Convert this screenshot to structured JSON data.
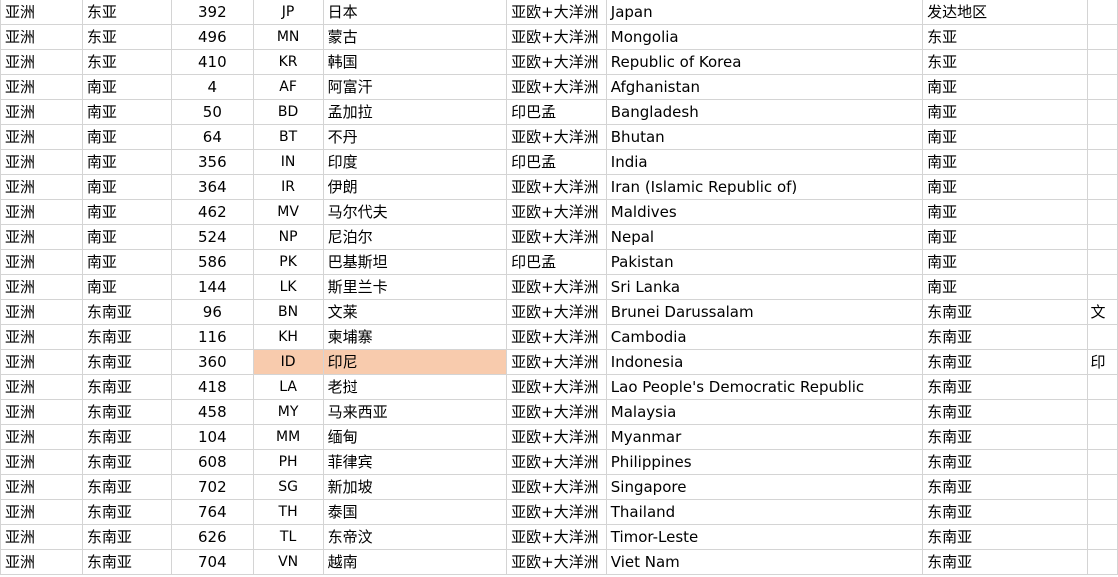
{
  "sheet": {
    "highlight_color": "#f8cbad",
    "rows": [
      {
        "continent": "亚洲",
        "region": "东亚",
        "number": "392",
        "code": "JP",
        "name_zh": "日本",
        "group": "亚欧+大洋洲",
        "name_en": "Japan",
        "category": "发达地区",
        "extra": ""
      },
      {
        "continent": "亚洲",
        "region": "东亚",
        "number": "496",
        "code": "MN",
        "name_zh": "蒙古",
        "group": "亚欧+大洋洲",
        "name_en": "Mongolia",
        "category": "东亚",
        "extra": ""
      },
      {
        "continent": "亚洲",
        "region": "东亚",
        "number": "410",
        "code": "KR",
        "name_zh": "韩国",
        "group": "亚欧+大洋洲",
        "name_en": "Republic of Korea",
        "category": "东亚",
        "extra": ""
      },
      {
        "continent": "亚洲",
        "region": "南亚",
        "number": "4",
        "code": "AF",
        "name_zh": "阿富汗",
        "group": "亚欧+大洋洲",
        "name_en": "Afghanistan",
        "category": "南亚",
        "extra": ""
      },
      {
        "continent": "亚洲",
        "region": "南亚",
        "number": "50",
        "code": "BD",
        "name_zh": "孟加拉",
        "group": "印巴孟",
        "name_en": "Bangladesh",
        "category": "南亚",
        "extra": ""
      },
      {
        "continent": "亚洲",
        "region": "南亚",
        "number": "64",
        "code": "BT",
        "name_zh": "不丹",
        "group": "亚欧+大洋洲",
        "name_en": "Bhutan",
        "category": "南亚",
        "extra": ""
      },
      {
        "continent": "亚洲",
        "region": "南亚",
        "number": "356",
        "code": "IN",
        "name_zh": "印度",
        "group": "印巴孟",
        "name_en": "India",
        "category": "南亚",
        "extra": ""
      },
      {
        "continent": "亚洲",
        "region": "南亚",
        "number": "364",
        "code": "IR",
        "name_zh": "伊朗",
        "group": "亚欧+大洋洲",
        "name_en": "Iran (Islamic Republic of)",
        "category": "南亚",
        "extra": ""
      },
      {
        "continent": "亚洲",
        "region": "南亚",
        "number": "462",
        "code": "MV",
        "name_zh": "马尔代夫",
        "group": "亚欧+大洋洲",
        "name_en": "Maldives",
        "category": "南亚",
        "extra": ""
      },
      {
        "continent": "亚洲",
        "region": "南亚",
        "number": "524",
        "code": "NP",
        "name_zh": "尼泊尔",
        "group": "亚欧+大洋洲",
        "name_en": "Nepal",
        "category": "南亚",
        "extra": ""
      },
      {
        "continent": "亚洲",
        "region": "南亚",
        "number": "586",
        "code": "PK",
        "name_zh": "巴基斯坦",
        "group": "印巴孟",
        "name_en": "Pakistan",
        "category": "南亚",
        "extra": ""
      },
      {
        "continent": "亚洲",
        "region": "南亚",
        "number": "144",
        "code": "LK",
        "name_zh": "斯里兰卡",
        "group": "亚欧+大洋洲",
        "name_en": "Sri Lanka",
        "category": "南亚",
        "extra": ""
      },
      {
        "continent": "亚洲",
        "region": "东南亚",
        "number": "96",
        "code": "BN",
        "name_zh": "文莱",
        "group": "亚欧+大洋洲",
        "name_en": "Brunei Darussalam",
        "category": "东南亚",
        "extra": "文"
      },
      {
        "continent": "亚洲",
        "region": "东南亚",
        "number": "116",
        "code": "KH",
        "name_zh": "柬埔寨",
        "group": "亚欧+大洋洲",
        "name_en": "Cambodia",
        "category": "东南亚",
        "extra": ""
      },
      {
        "continent": "亚洲",
        "region": "东南亚",
        "number": "360",
        "code": "ID",
        "name_zh": "印尼",
        "group": "亚欧+大洋洲",
        "name_en": "Indonesia",
        "category": "东南亚",
        "extra": "印",
        "highlight": true
      },
      {
        "continent": "亚洲",
        "region": "东南亚",
        "number": "418",
        "code": "LA",
        "name_zh": "老挝",
        "group": "亚欧+大洋洲",
        "name_en": "Lao People's Democratic Republic",
        "category": "东南亚",
        "extra": ""
      },
      {
        "continent": "亚洲",
        "region": "东南亚",
        "number": "458",
        "code": "MY",
        "name_zh": "马来西亚",
        "group": "亚欧+大洋洲",
        "name_en": "Malaysia",
        "category": "东南亚",
        "extra": ""
      },
      {
        "continent": "亚洲",
        "region": "东南亚",
        "number": "104",
        "code": "MM",
        "name_zh": "缅甸",
        "group": "亚欧+大洋洲",
        "name_en": "Myanmar",
        "category": "东南亚",
        "extra": ""
      },
      {
        "continent": "亚洲",
        "region": "东南亚",
        "number": "608",
        "code": "PH",
        "name_zh": "菲律宾",
        "group": "亚欧+大洋洲",
        "name_en": "Philippines",
        "category": "东南亚",
        "extra": ""
      },
      {
        "continent": "亚洲",
        "region": "东南亚",
        "number": "702",
        "code": "SG",
        "name_zh": "新加坡",
        "group": "亚欧+大洋洲",
        "name_en": "Singapore",
        "category": "东南亚",
        "extra": ""
      },
      {
        "continent": "亚洲",
        "region": "东南亚",
        "number": "764",
        "code": "TH",
        "name_zh": "泰国",
        "group": "亚欧+大洋洲",
        "name_en": "Thailand",
        "category": "东南亚",
        "extra": ""
      },
      {
        "continent": "亚洲",
        "region": "东南亚",
        "number": "626",
        "code": "TL",
        "name_zh": "东帝汶",
        "group": "亚欧+大洋洲",
        "name_en": "Timor-Leste",
        "category": "东南亚",
        "extra": ""
      },
      {
        "continent": "亚洲",
        "region": "东南亚",
        "number": "704",
        "code": "VN",
        "name_zh": "越南",
        "group": "亚欧+大洋洲",
        "name_en": "Viet Nam",
        "category": "东南亚",
        "extra": ""
      }
    ]
  }
}
